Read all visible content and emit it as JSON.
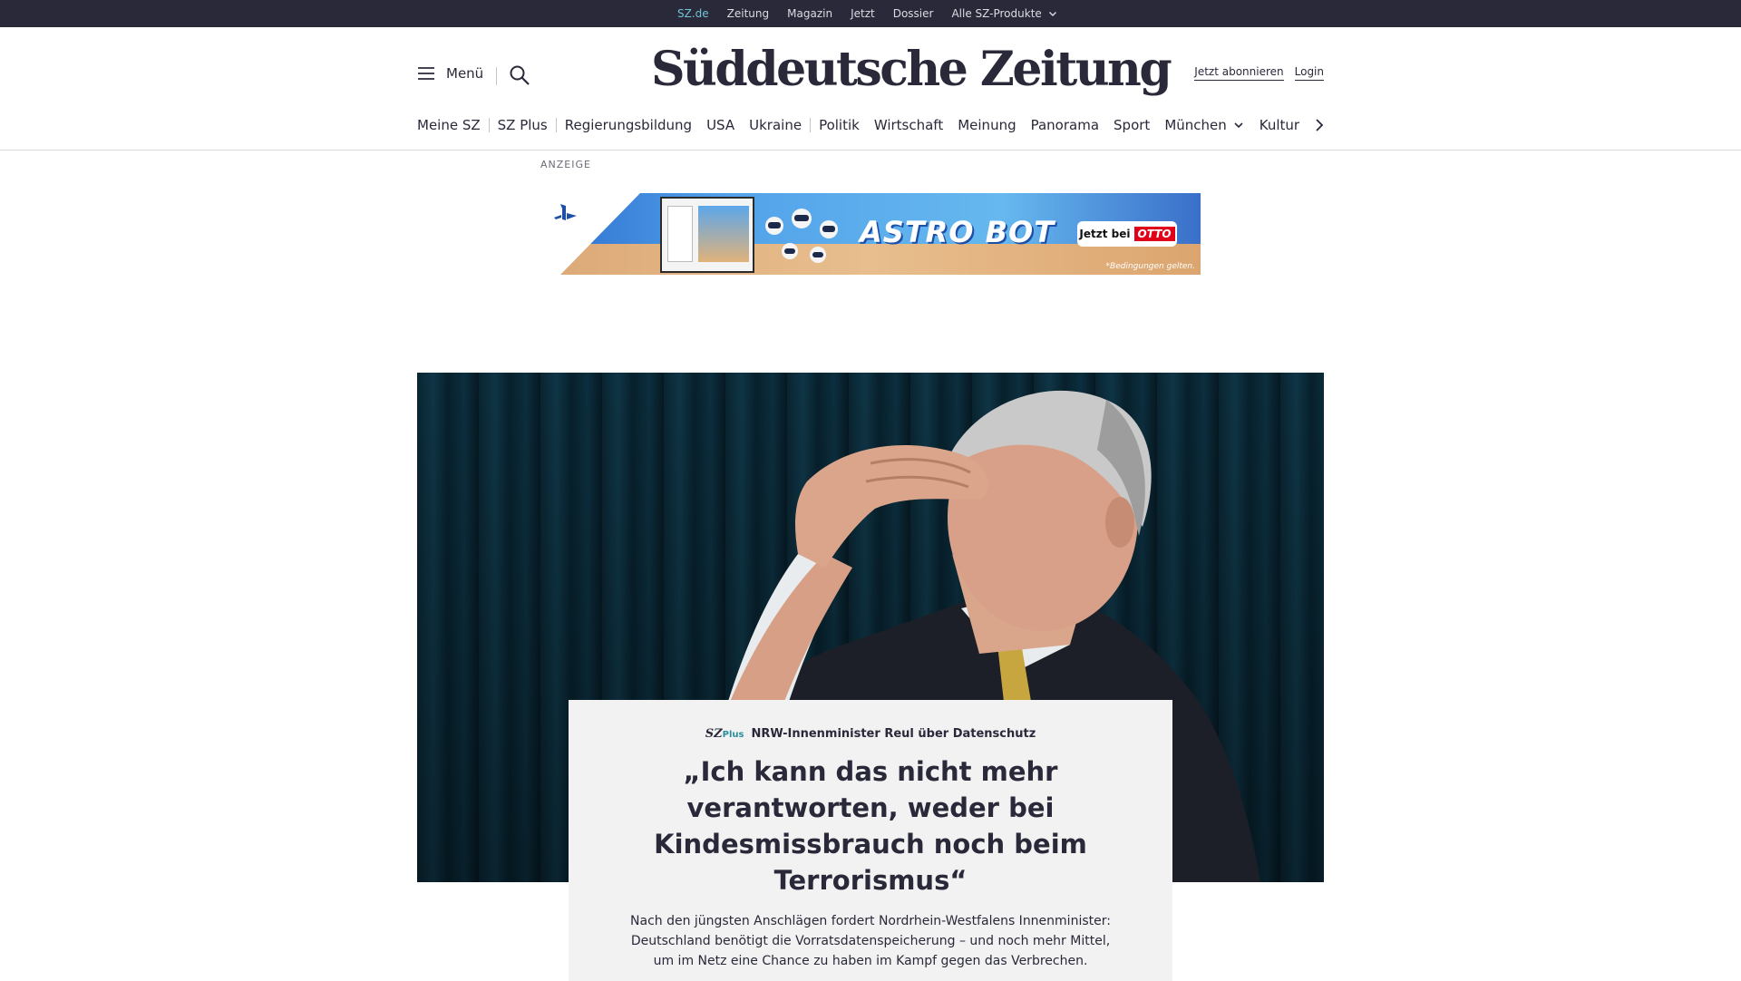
{
  "topbar": {
    "items": [
      {
        "label": "SZ.de",
        "active": true
      },
      {
        "label": "Zeitung"
      },
      {
        "label": "Magazin"
      },
      {
        "label": "Jetzt"
      },
      {
        "label": "Dossier"
      },
      {
        "label": "Alle SZ-Produkte",
        "dropdown": true
      }
    ]
  },
  "header": {
    "menu_label": "Menü",
    "logo": "Süddeutsche Zeitung",
    "subscribe_label": "Jetzt abonnieren",
    "login_label": "Login"
  },
  "nav": {
    "items": [
      {
        "label": "Meine SZ"
      },
      {
        "label": "SZ Plus"
      },
      {
        "label": "Regierungsbildung"
      },
      {
        "label": "USA"
      },
      {
        "label": "Ukraine"
      },
      {
        "label": "Politik"
      },
      {
        "label": "Wirtschaft"
      },
      {
        "label": "Meinung"
      },
      {
        "label": "Panorama"
      },
      {
        "label": "Sport"
      },
      {
        "label": "München",
        "dropdown": true
      },
      {
        "label": "Kultur"
      }
    ]
  },
  "ad": {
    "label": "ANZEIGE",
    "title": "ASTRO BOT",
    "cta_prefix": "Jetzt bei",
    "cta_brand": "OTTO",
    "fineprint": "*Bedingungen gelten."
  },
  "teaser": {
    "badge_main": "SZ",
    "badge_sub": "Plus",
    "kicker": "NRW-Innenminister Reul über Datenschutz",
    "headline": "„Ich kann das nicht mehr verantworten, weder bei Kindesmissbrauch noch beim Terrorismus“",
    "lead": "Nach den jüngsten Anschlägen fordert Nordrhein-Westfalens Innenminister: Deutschland benötigt die Vorratsdatenspeicherung – und noch mehr Mittel, um im Netz eine Chance zu haben im Kampf gegen das Verbrechen."
  },
  "colors": {
    "topbar_bg": "#29293a",
    "active_link": "#71c5d4",
    "text": "#29293a",
    "card_bg": "#f2f2f2",
    "plus_accent": "#2a8e9e"
  }
}
